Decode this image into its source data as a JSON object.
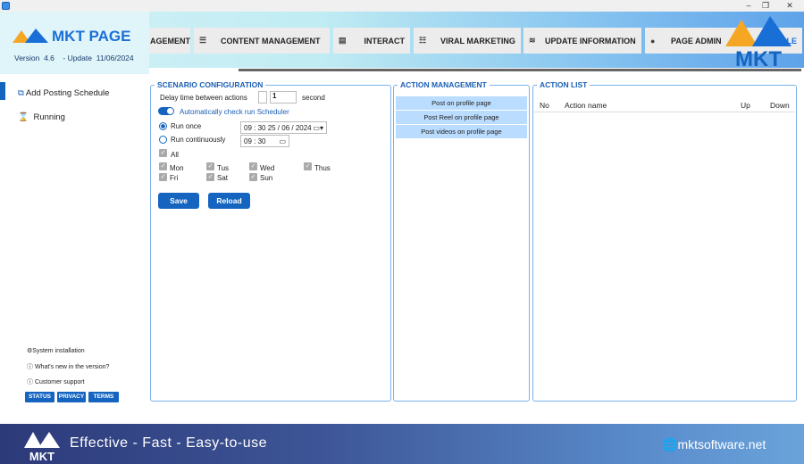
{
  "window": {
    "minimize": "–",
    "restore": "❐",
    "close": "✕"
  },
  "brand": {
    "name": "MKT PAGE",
    "version_label": "Version",
    "version": "4.6",
    "update_label": "- Update",
    "update_date": "11/06/2024",
    "logo_text": "MKT",
    "tagline": "Effective - Fast - Easy-to-use",
    "website": "mktsoftware.net"
  },
  "nav": {
    "tabs": [
      {
        "label": "AGEMENT",
        "icon": "user-icon"
      },
      {
        "label": "CONTENT MANAGEMENT",
        "icon": "list-icon"
      },
      {
        "label": "INTERACT",
        "icon": "message-icon"
      },
      {
        "label": "VIRAL MARKETING",
        "icon": "group-icon"
      },
      {
        "label": "UPDATE INFORMATION",
        "icon": "signal-icon"
      },
      {
        "label": "PAGE ADMIN",
        "icon": "facebook-icon"
      },
      {
        "label": "LE",
        "icon": ""
      }
    ]
  },
  "sidebar": {
    "items": [
      {
        "label": "Add Posting Schedule",
        "icon": "copy-icon",
        "active": true
      },
      {
        "label": "Running",
        "icon": "hourglass-icon"
      }
    ],
    "links": [
      {
        "label": "System installation",
        "icon": "gear-icon"
      },
      {
        "label": "What's new in the version?",
        "icon": "info-icon"
      },
      {
        "label": "Customer support",
        "icon": "help-icon"
      }
    ],
    "buttons": [
      "STATUS",
      "PRIVACY",
      "TERMS"
    ]
  },
  "scenario": {
    "title": "SCENARIO CONFIGURATION",
    "delay_label": "Delay time between actions",
    "delay_value": "1",
    "delay_unit": "second",
    "auto_check_label": "Automatically check run Scheduler",
    "auto_check_on": true,
    "run_once_label": "Run once",
    "run_once_value": "09 : 30 25 / 06 / 2024",
    "run_cont_label": "Run continuously",
    "run_cont_value": "09 : 30",
    "run_mode": "once",
    "all_label": "All",
    "days": [
      "Mon",
      "Tus",
      "Wed",
      "Thus",
      "Fri",
      "Sat",
      "Sun"
    ],
    "save": "Save",
    "reload": "Reload"
  },
  "actions": {
    "title": "ACTION MANAGEMENT",
    "items": [
      "Post on profile page",
      "Post Reel on profile page",
      "Post videos on profile page"
    ]
  },
  "action_list": {
    "title": "ACTION LIST",
    "columns": [
      "No",
      "Action name",
      "Up",
      "Down"
    ]
  },
  "colors": {
    "accent": "#1565c0",
    "panel_border": "#7ab2ea",
    "action_bg": "#b9dcff"
  }
}
